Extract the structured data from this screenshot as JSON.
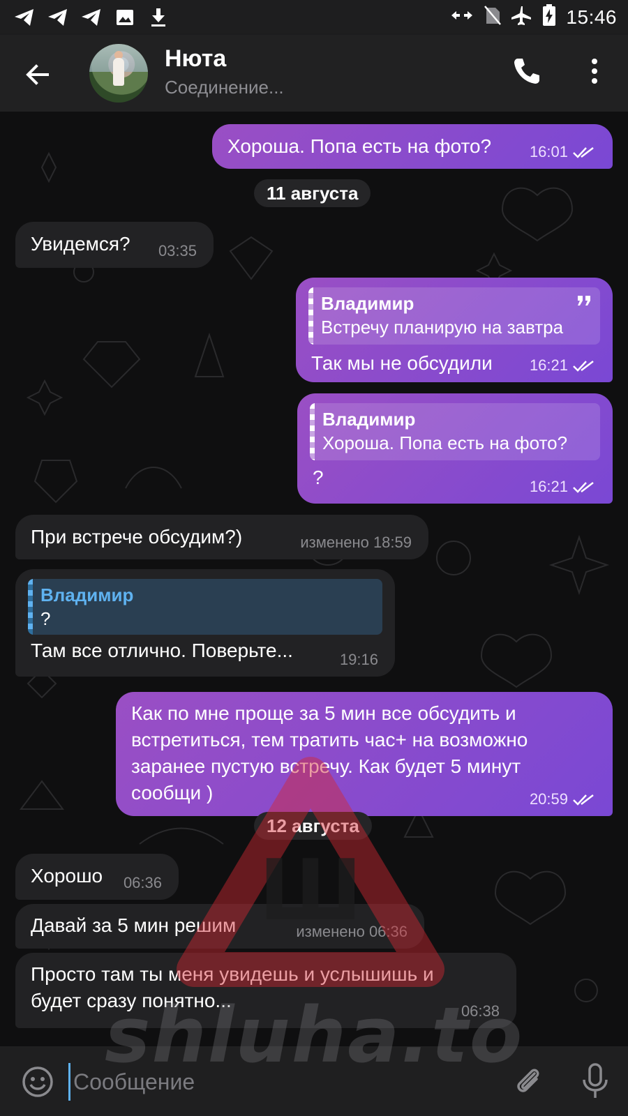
{
  "status_bar": {
    "time": "15:46",
    "left_icons": [
      "telegram-icon",
      "telegram-icon",
      "telegram-icon",
      "image-icon",
      "download-icon"
    ],
    "right_icons": [
      "data-arrows-icon",
      "no-sim-icon",
      "airplane-icon",
      "battery-charging-icon"
    ]
  },
  "header": {
    "name": "Нюта",
    "status": "Соединение..."
  },
  "messages": [
    {
      "text": "Хороша. Попа есть на фото?",
      "time": "16:01"
    },
    {
      "date": "11 августа"
    },
    {
      "text": "Увидемся?",
      "time": "03:35"
    },
    {
      "reply_name": "Владимир",
      "reply_text": "Встречу планирую на завтра",
      "text": "Так мы не обсудили",
      "time": "16:21"
    },
    {
      "reply_name": "Владимир",
      "reply_text": "Хороша. Попа есть на фото?",
      "text": "?",
      "time": "16:21"
    },
    {
      "text": "При встрече  обсудим?)",
      "time": "изменено 18:59"
    },
    {
      "reply_name": "Владимир",
      "reply_text": "?",
      "text": "Там все отлично. Поверьте...",
      "time": "19:16"
    },
    {
      "lines": [
        "Как по мне проще за 5 мин все обсудить и",
        "встретиться, тем тратить час+ на возможно",
        "заранее пустую встречу. Как будет 5 минут",
        "сообщи )"
      ],
      "time": "20:59"
    },
    {
      "date": "12 августа"
    },
    {
      "text": "Хорошо",
      "time": "06:36"
    },
    {
      "text": "Давай за  5 мин решим",
      "time": "изменено 06:36"
    },
    {
      "lines": [
        "Просто там ты меня увидешь и услышишь и",
        "будет сразу понятно..."
      ],
      "time": "06:38"
    }
  ],
  "input": {
    "placeholder": "Сообщение"
  },
  "watermark": {
    "text": "shluha.to",
    "logo_letter": "Ш"
  },
  "colors": {
    "outgoing_bubble": "#8a4cc9",
    "incoming_bubble": "#222224",
    "reply_name_incoming": "#5fb2f0",
    "background": "#0f0f10"
  }
}
